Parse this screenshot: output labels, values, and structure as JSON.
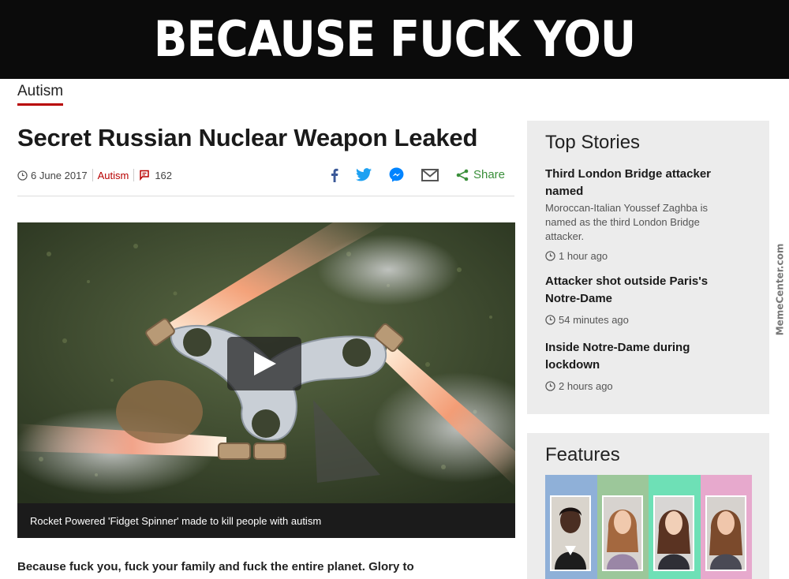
{
  "banner": {
    "text": "BECAUSE FUCK YOU"
  },
  "article": {
    "section": "Autism",
    "headline": "Secret Russian Nuclear Weapon Leaked",
    "date": "6 June 2017",
    "category": "Autism",
    "comment_count": "162",
    "share_label": "Share",
    "video_caption": "Rocket Powered 'Fidget Spinner' made to kill people with autism",
    "body_first_line": "Because fuck you, fuck your family and fuck the entire planet. Glory to"
  },
  "share_icons": [
    "facebook-icon",
    "twitter-icon",
    "messenger-icon",
    "email-icon",
    "share-icon"
  ],
  "top_stories": {
    "title": "Top Stories",
    "items": [
      {
        "title": "Third London Bridge attacker named",
        "summary": "Moroccan-Italian Youssef Zaghba is named as the third London Bridge attacker.",
        "time": "1 hour ago"
      },
      {
        "title": "Attacker shot outside Paris's Notre-Dame",
        "summary": "",
        "time": "54 minutes ago"
      },
      {
        "title": "Inside Notre-Dame during lockdown",
        "summary": "",
        "time": "2 hours ago"
      }
    ]
  },
  "features": {
    "title": "Features",
    "tile_colors": [
      "#8fb0d8",
      "#9cc79a",
      "#6ee0b6",
      "#e7a9cd"
    ]
  },
  "colors": {
    "accent_red": "#b80000",
    "share_green": "#3a8f3a",
    "facebook": "#3b5998",
    "twitter": "#1da1f2",
    "messenger": "#0084ff"
  },
  "watermark": {
    "text": "MemeCenter.com"
  }
}
